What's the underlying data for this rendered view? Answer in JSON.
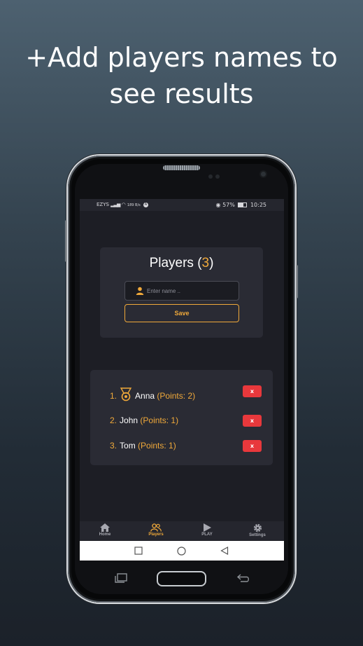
{
  "headline": {
    "line1": "+Add players names to",
    "line2": "see results"
  },
  "status_bar": {
    "carrier": "EZYS",
    "data_rate": "189 B/s",
    "battery": "57%",
    "time": "10:25"
  },
  "players_card": {
    "title": "Players",
    "count_open": "(",
    "count": "3",
    "count_close": ")",
    "input_placeholder": "Enter name ..",
    "save_label": "Save"
  },
  "players": [
    {
      "rank": "1.",
      "name": "Anna",
      "points": "(Points: 2)",
      "delete_label": "x",
      "medal": true
    },
    {
      "rank": "2.",
      "name": "John",
      "points": "(Points: 1)",
      "delete_label": "x",
      "medal": false
    },
    {
      "rank": "3.",
      "name": "Tom",
      "points": "(Points: 1)",
      "delete_label": "x",
      "medal": false
    }
  ],
  "bottom_nav": {
    "items": [
      {
        "label": "Home",
        "icon": "home-icon"
      },
      {
        "label": "Players",
        "icon": "users-icon"
      },
      {
        "label": "PLAY",
        "icon": "play-icon"
      },
      {
        "label": "Settings",
        "icon": "gear-icon"
      }
    ],
    "active": "Players"
  },
  "colors": {
    "accent": "#f0a93a",
    "danger": "#e8383c",
    "screen_bg": "#1d1e25",
    "card_bg": "#2a2b34"
  }
}
